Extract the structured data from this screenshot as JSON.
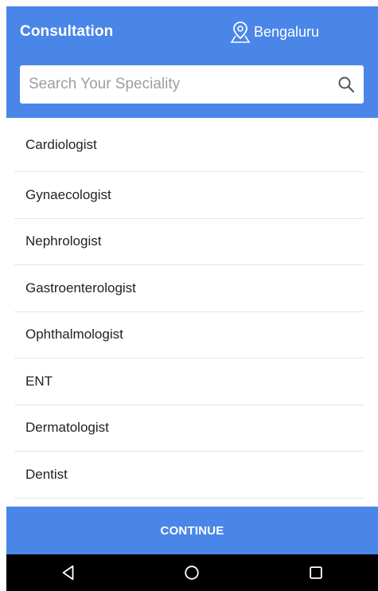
{
  "header": {
    "title": "Consultation",
    "location": "Bengaluru",
    "location_icon": "location-pin-icon"
  },
  "search": {
    "placeholder": "Search Your Speciality",
    "value": "",
    "icon": "search-icon"
  },
  "specialities": [
    {
      "label": "Cardiologist"
    },
    {
      "label": "Gynaecologist"
    },
    {
      "label": "Nephrologist"
    },
    {
      "label": "Gastroenterologist"
    },
    {
      "label": "Ophthalmologist"
    },
    {
      "label": "ENT"
    },
    {
      "label": "Dermatologist"
    },
    {
      "label": "Dentist"
    }
  ],
  "footer": {
    "continue_label": "CONTINUE"
  },
  "navbar": {
    "icons": [
      "back-triangle-icon",
      "home-circle-icon",
      "recents-square-icon"
    ]
  },
  "colors": {
    "primary": "#4a86e8",
    "navbar": "#000000",
    "text": "#222222",
    "divider": "#e6e6e6"
  }
}
